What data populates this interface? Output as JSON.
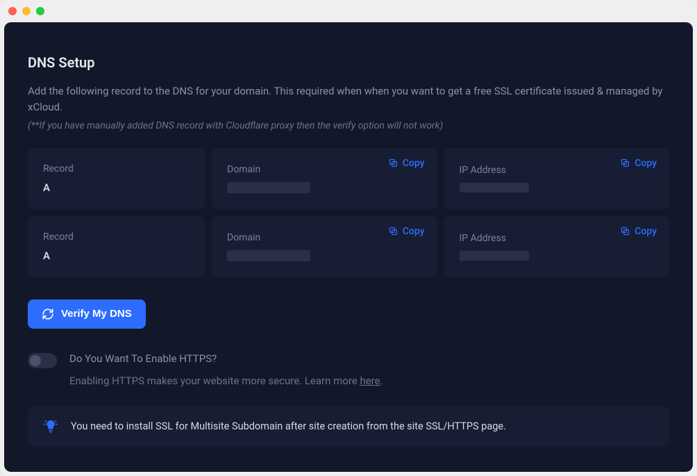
{
  "header": {
    "title": "DNS Setup",
    "description": "Add the following record to the DNS for your domain. This required when when you want to get a free SSL certificate issued & managed by xCloud.",
    "note": "(**If you have manually added DNS record with Cloudflare proxy then the verify option will not work)"
  },
  "labels": {
    "record": "Record",
    "domain": "Domain",
    "ip": "IP Address",
    "copy": "Copy"
  },
  "dns_rows": [
    {
      "record": "A"
    },
    {
      "record": "A"
    }
  ],
  "verify_button": "Verify My DNS",
  "https_toggle": {
    "label": "Do You Want To Enable HTTPS?",
    "hint_text": "Enabling HTTPS makes your website more secure. Learn more ",
    "hint_link": "here",
    "hint_tail": "."
  },
  "banner": {
    "message": "You need to install SSL for Multisite Subdomain after site creation from the site SSL/HTTPS page."
  }
}
